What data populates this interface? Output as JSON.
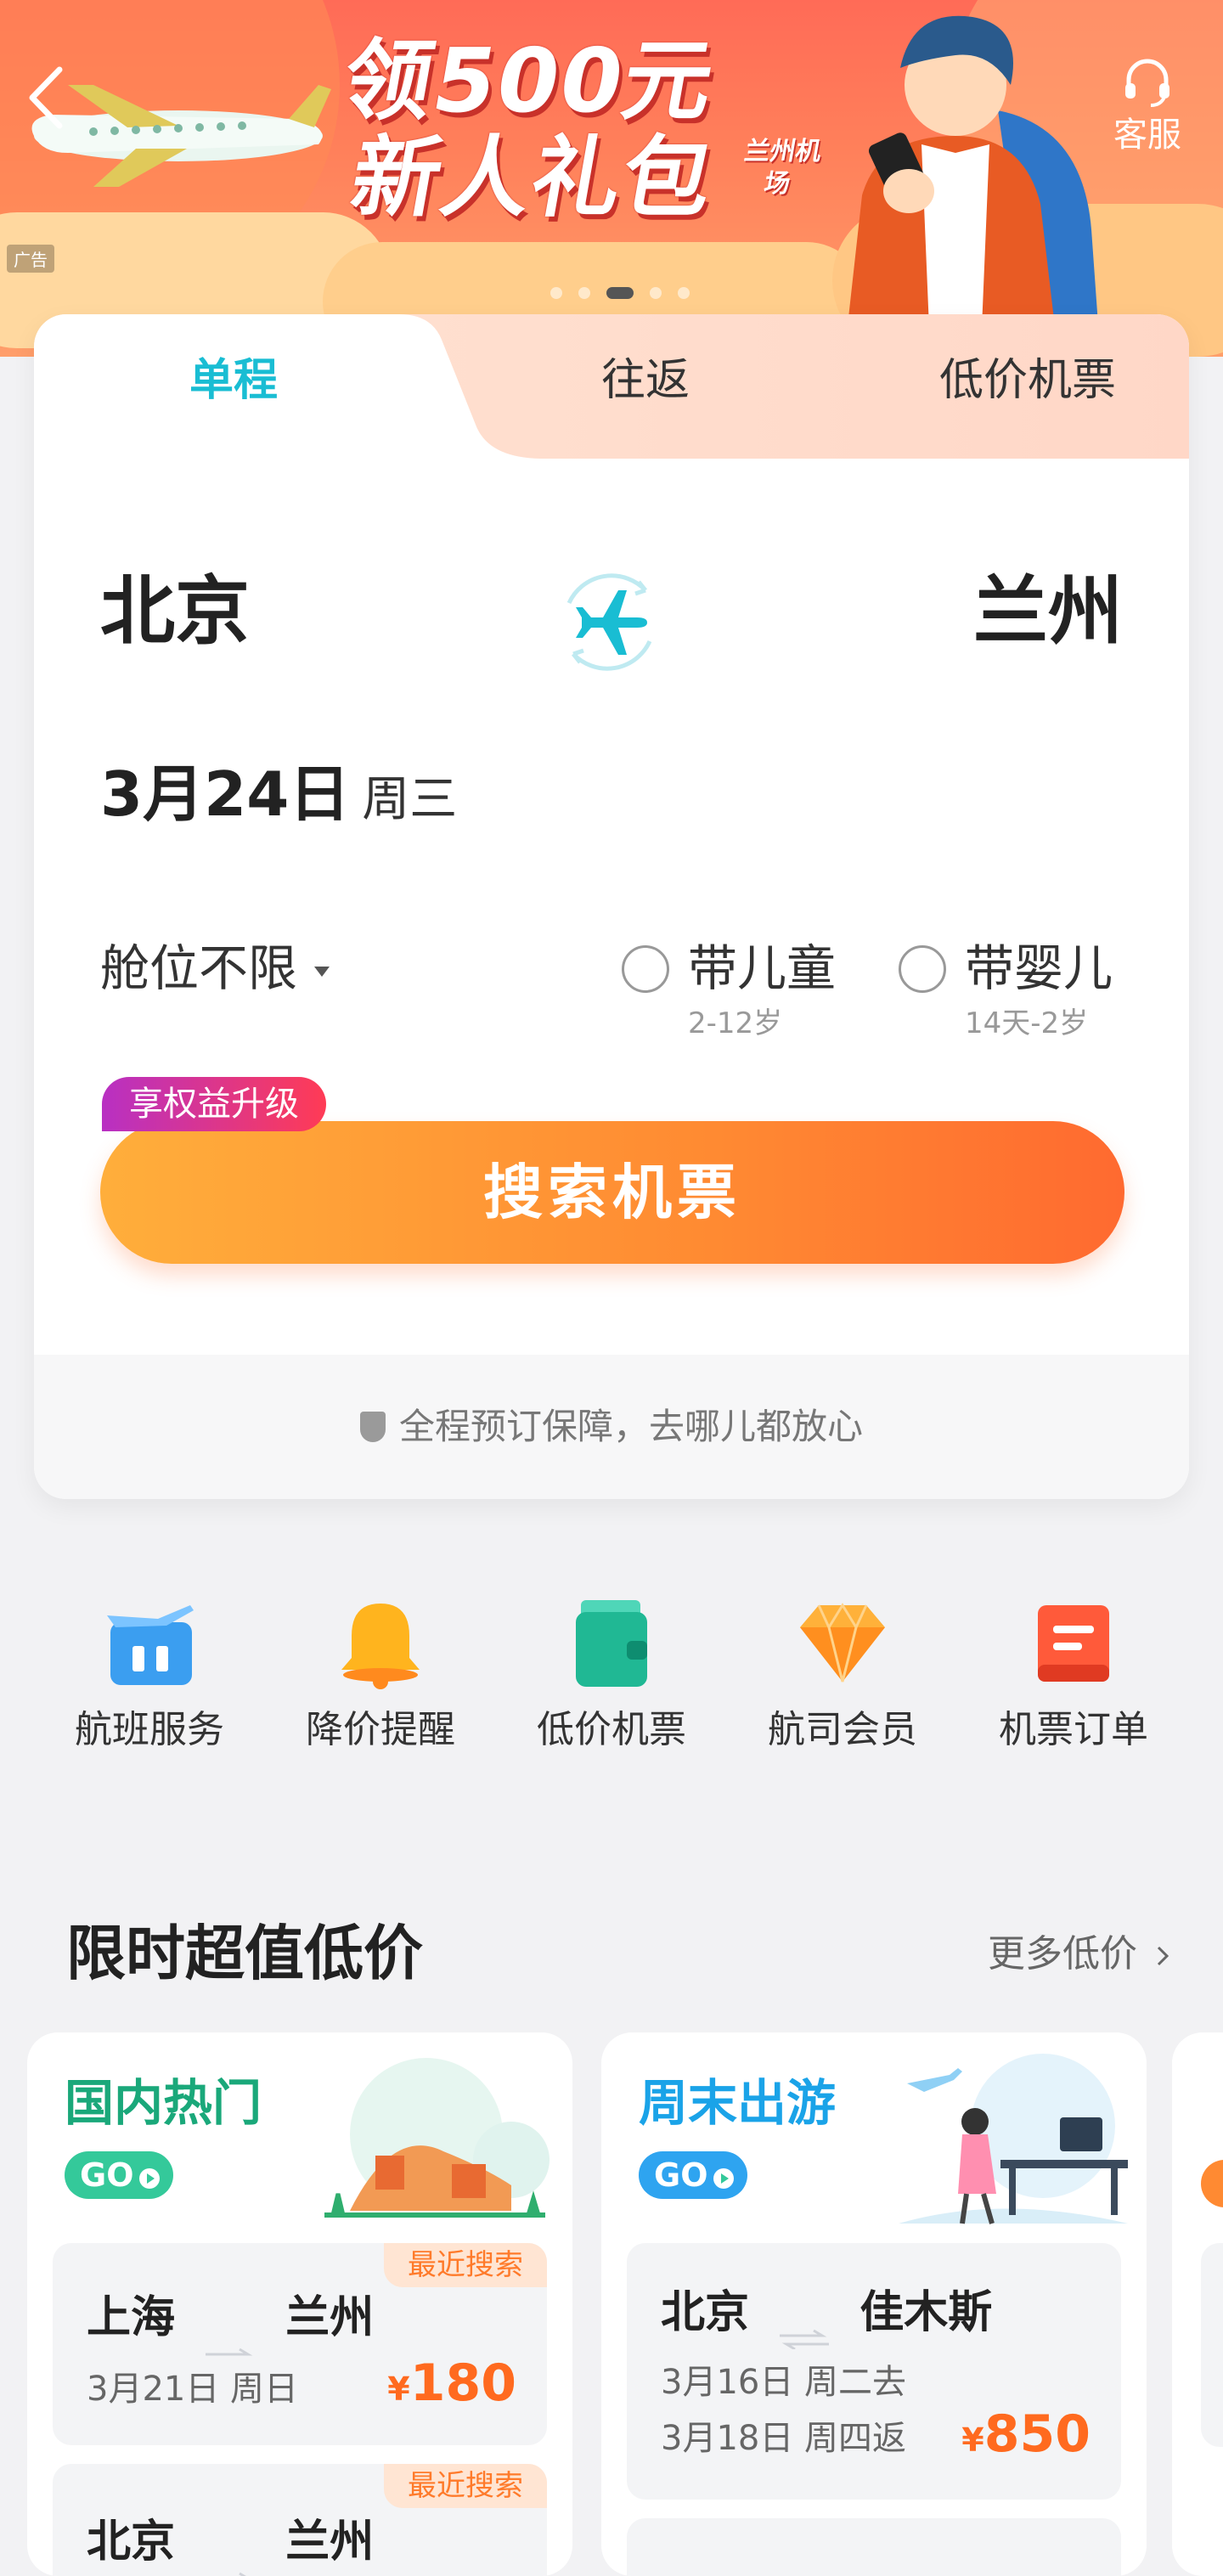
{
  "banner": {
    "title_line1": "领500元",
    "title_line2": "新人礼包",
    "badge": "兰州机场",
    "ad_tag": "广告",
    "service_label": "客服"
  },
  "tabs": [
    {
      "label": "单程",
      "active": true
    },
    {
      "label": "往返",
      "active": false
    },
    {
      "label": "低价机票",
      "active": false
    }
  ],
  "search": {
    "from_city": "北京",
    "to_city": "兰州",
    "date": "3月24日",
    "weekday": "周三",
    "cabin": "舱位不限",
    "with_child": "带儿童",
    "child_age": "2-12岁",
    "with_infant": "带婴儿",
    "infant_age": "14天-2岁",
    "perk_badge": "享权益升级",
    "search_button": "搜索机票",
    "assurance": "全程预订保障，去哪儿都放心"
  },
  "quick_links": [
    {
      "label": "航班服务",
      "icon": "flight-service-icon"
    },
    {
      "label": "降价提醒",
      "icon": "bell-icon"
    },
    {
      "label": "低价机票",
      "icon": "wallet-icon"
    },
    {
      "label": "航司会员",
      "icon": "diamond-icon"
    },
    {
      "label": "机票订单",
      "icon": "order-icon"
    }
  ],
  "deals": {
    "title": "限时超值低价",
    "more": "更多低价",
    "cards": [
      {
        "title": "国内热门",
        "go": "GO",
        "routes": [
          {
            "tag": "最近搜索",
            "from": "上海",
            "to": "兰州",
            "date": "3月21日 周日",
            "price": "180",
            "currency": "¥"
          },
          {
            "tag": "最近搜索",
            "from": "北京",
            "to": "兰州"
          }
        ]
      },
      {
        "title": "周末出游",
        "go": "GO",
        "routes": [
          {
            "from": "北京",
            "to": "佳木斯",
            "date_out": "3月16日 周二去",
            "date_back": "3月18日 周四返",
            "price": "850",
            "currency": "¥"
          }
        ]
      }
    ]
  },
  "colors": {
    "accent_teal": "#19bdd3",
    "orange": "#ff7a2a",
    "price": "#ff6a1f",
    "green": "#1aa87a",
    "blue": "#1aa3e8"
  }
}
